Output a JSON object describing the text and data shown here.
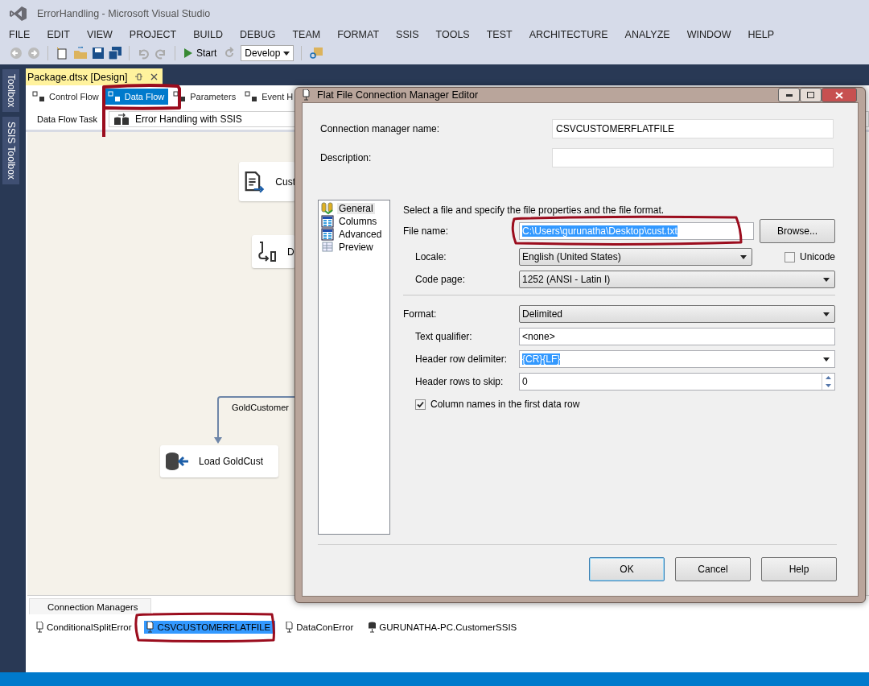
{
  "window": {
    "title": "ErrorHandling - Microsoft Visual Studio"
  },
  "menu": [
    "FILE",
    "EDIT",
    "VIEW",
    "PROJECT",
    "BUILD",
    "DEBUG",
    "TEAM",
    "FORMAT",
    "SSIS",
    "TOOLS",
    "TEST",
    "ARCHITECTURE",
    "ANALYZE",
    "WINDOW",
    "HELP"
  ],
  "toolbar": {
    "start_label": "Start",
    "configuration": "Develop"
  },
  "side_tabs": [
    "Toolbox",
    "SSIS Toolbox"
  ],
  "document_tab": {
    "title": "Package.dtsx [Design]"
  },
  "designer_tabs": [
    {
      "label": "Control Flow",
      "selected": false
    },
    {
      "label": "Data Flow",
      "selected": true
    },
    {
      "label": "Parameters",
      "selected": false
    },
    {
      "label": "Event H",
      "selected": false
    }
  ],
  "task_row": {
    "label": "Data Flow Task",
    "value": "Error Handling with SSIS"
  },
  "canvas": {
    "nodes": [
      {
        "kind": "source",
        "label": "Cust"
      },
      {
        "kind": "split",
        "label": "D"
      },
      {
        "kind": "destination",
        "label": "Load GoldCust"
      }
    ],
    "path_label": "GoldCustomer"
  },
  "dialog": {
    "title": "Flat File Connection Manager Editor",
    "name_label": "Connection manager name:",
    "name_value": "CSVCUSTOMERFLATFILE",
    "description_label": "Description:",
    "pages": [
      {
        "label": "General",
        "kind": "general",
        "selected": true
      },
      {
        "label": "Columns",
        "kind": "grid",
        "selected": false
      },
      {
        "label": "Advanced",
        "kind": "grid",
        "selected": false
      },
      {
        "label": "Preview",
        "kind": "preview",
        "selected": false
      }
    ],
    "intro": "Select a file and specify the file properties and the file format.",
    "file_name_label": "File name:",
    "file_name_value": "C:\\Users\\gurunatha\\Desktop\\cust.txt",
    "browse_button": "Browse...",
    "locale_label": "Locale:",
    "locale_value": "English (United States)",
    "unicode": {
      "label": "Unicode",
      "checked": false
    },
    "code_page_label": "Code page:",
    "code_page_value": "1252  (ANSI - Latin I)",
    "format_label": "Format:",
    "format_value": "Delimited",
    "text_qualifier_label": "Text qualifier:",
    "text_qualifier_value": "<none>",
    "header_delimiter_label": "Header row delimiter:",
    "header_delimiter_value": "{CR}{LF}",
    "header_skip_label": "Header rows to skip:",
    "header_skip_value": "0",
    "column_names": {
      "label": "Column names in the first data row",
      "checked": true
    },
    "buttons": [
      "OK",
      "Cancel",
      "Help"
    ]
  },
  "connection_managers": {
    "title": "Connection Managers",
    "items": [
      {
        "label": "ConditionalSplitError",
        "kind": "file",
        "selected": false
      },
      {
        "label": "CSVCUSTOMERFLATFILE",
        "kind": "file",
        "selected": true
      },
      {
        "label": "DataConError",
        "kind": "file",
        "selected": false
      },
      {
        "label": "GURUNATHA-PC.CustomerSSIS",
        "kind": "database",
        "selected": false
      }
    ]
  }
}
